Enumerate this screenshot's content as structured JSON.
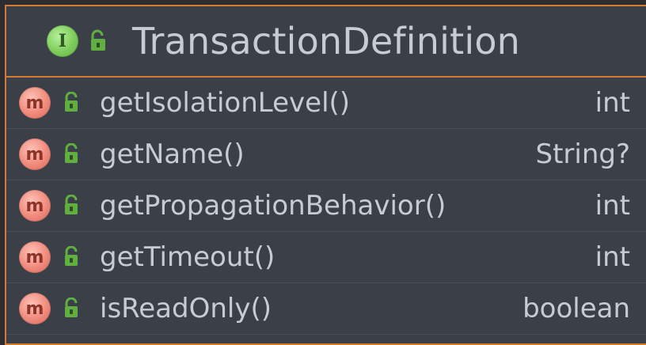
{
  "header": {
    "badge_letter": "I",
    "title": "TransactionDefinition",
    "icon_kind": "interface-icon",
    "visibility_icon": "public-lock-icon"
  },
  "colors": {
    "border": "#d57a31",
    "background": "#3b3f47",
    "text": "#c8cbd1",
    "interface_badge": "#7dcc5b",
    "method_badge": "#f08a7c",
    "lock_green": "#5fb040"
  },
  "methods": [
    {
      "badge": "m",
      "name": "getIsolationLevel()",
      "type": "int"
    },
    {
      "badge": "m",
      "name": "getName()",
      "type": "String?"
    },
    {
      "badge": "m",
      "name": "getPropagationBehavior()",
      "type": "int"
    },
    {
      "badge": "m",
      "name": "getTimeout()",
      "type": "int"
    },
    {
      "badge": "m",
      "name": "isReadOnly()",
      "type": "boolean"
    }
  ]
}
